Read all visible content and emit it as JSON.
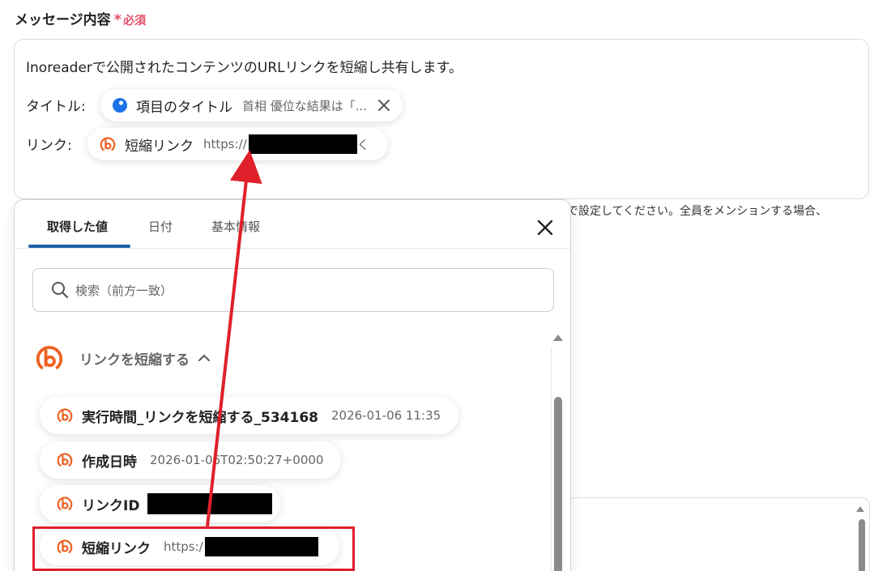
{
  "field": {
    "label": "メッセージ内容",
    "required_star": "*",
    "required_text": "必須"
  },
  "message": {
    "line1": "Inoreaderで公開されたコンテンツのURLリンクを短縮し共有します。",
    "title_label": "タイトル:",
    "title_chip": {
      "name": "項目のタイトル",
      "value": "首相 優位な結果は「...",
      "icon": "blue-dot-icon"
    },
    "link_label": "リンク:",
    "link_chip": {
      "name": "短縮リンク",
      "value": "https://",
      "trailing": "く",
      "icon": "bitly-icon"
    }
  },
  "hint_text": "で設定してください。全員をメンションする場合、",
  "panel": {
    "tabs": [
      {
        "label": "取得した値",
        "active": true
      },
      {
        "label": "日付",
        "active": false
      },
      {
        "label": "基本情報",
        "active": false
      }
    ],
    "search_placeholder": "検索（前方一致）",
    "group_title": "リンクを短縮する",
    "items": [
      {
        "name": "実行時間_リンクを短縮する_534168",
        "value": "2026-01-06 11:35"
      },
      {
        "name": "作成日時",
        "value": "2026-01-06T02:50:27+0000"
      },
      {
        "name": "リンクID",
        "value": ""
      },
      {
        "name": "短縮リンク",
        "value": "https:/"
      }
    ]
  },
  "colors": {
    "accent": "#1f5fa8",
    "required": "#e5506a",
    "bitly_orange": "#ee6123",
    "highlight": "#e0202a",
    "blue_dot": "#1a73e8"
  }
}
